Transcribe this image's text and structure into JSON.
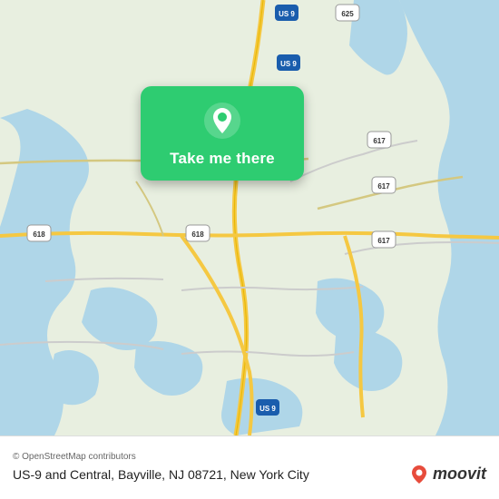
{
  "map": {
    "alt": "Map of Bayville NJ area showing US-9 and Central intersection"
  },
  "card": {
    "label": "Take me there",
    "pin_icon": "map-pin"
  },
  "bottom_bar": {
    "copyright": "© OpenStreetMap contributors",
    "location": "US-9 and Central, Bayville, NJ 08721, New York City",
    "moovit_label": "moovit"
  }
}
